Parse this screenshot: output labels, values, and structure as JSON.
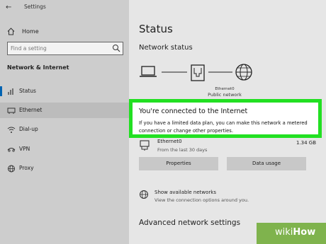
{
  "window": {
    "title": "Settings"
  },
  "sidebar": {
    "home_label": "Home",
    "search_placeholder": "Find a setting",
    "section_header": "Network & Internet",
    "items": [
      {
        "label": "Status",
        "icon": "status-icon",
        "selected": false
      },
      {
        "label": "Ethernet",
        "icon": "ethernet-icon",
        "selected": true
      },
      {
        "label": "Dial-up",
        "icon": "dialup-icon",
        "selected": false
      },
      {
        "label": "VPN",
        "icon": "vpn-icon",
        "selected": false
      },
      {
        "label": "Proxy",
        "icon": "proxy-icon",
        "selected": false
      }
    ]
  },
  "main": {
    "title": "Status",
    "network_status_header": "Network status",
    "diagram": {
      "adapter_name": "Ethernet0",
      "network_type": "Public network"
    },
    "callout": {
      "headline": "You're connected to the Internet",
      "body": "If you have a limited data plan, you can make this network a metered connection or change other properties."
    },
    "connection": {
      "name": "Ethernet0",
      "period": "From the last 30 days",
      "usage": "1.34 GB"
    },
    "buttons": {
      "properties": "Properties",
      "data_usage": "Data usage"
    },
    "show_networks": {
      "title": "Show available networks",
      "subtitle": "View the connection options around you."
    },
    "advanced_header": "Advanced network settings"
  },
  "watermark": {
    "part1": "wiki",
    "part2": "How"
  },
  "colors": {
    "accent": "#0063b1",
    "highlight": "#22e022",
    "watermark": "#7fb34d"
  }
}
